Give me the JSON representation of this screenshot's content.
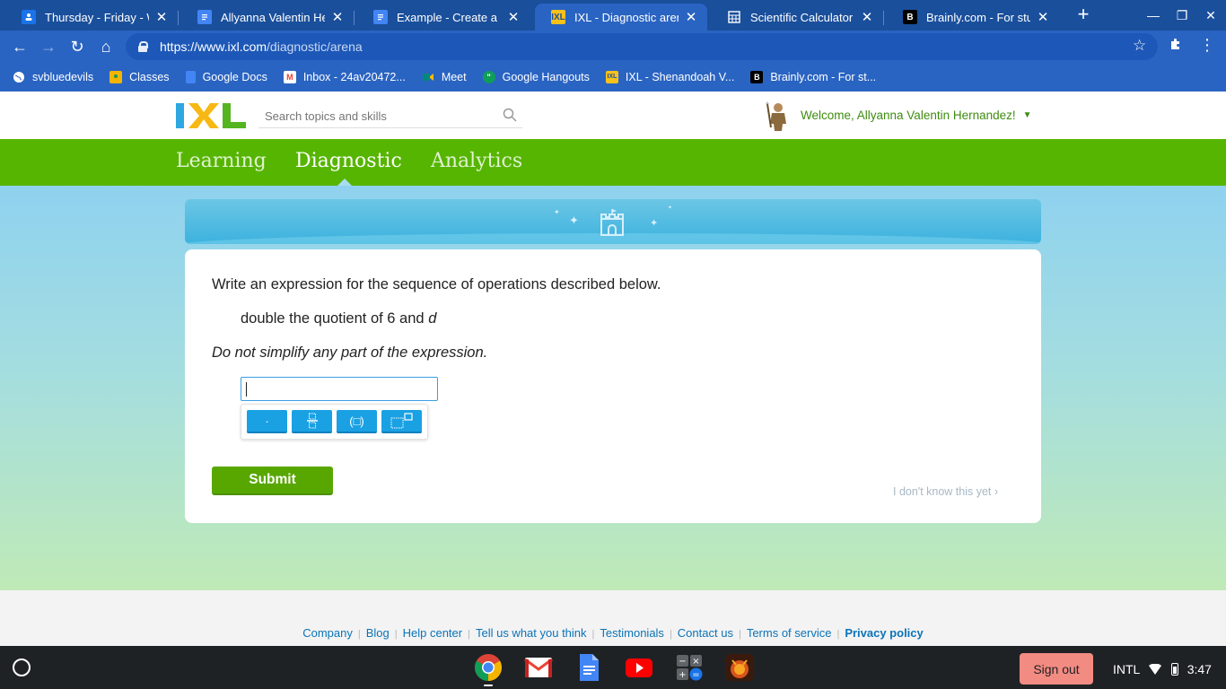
{
  "browser": {
    "tabs": [
      {
        "title": "Thursday - Friday - Wedn",
        "icon": "classroom-icon",
        "icon_color": "#1a73e8"
      },
      {
        "title": "Allyanna Valentin Herna",
        "icon": "docs-icon",
        "icon_color": "#4285f4"
      },
      {
        "title": "Example - Create a Char",
        "icon": "docs-icon",
        "icon_color": "#4285f4"
      },
      {
        "title": "IXL - Diagnostic arena",
        "icon": "ixl-icon",
        "icon_color": "#f9c11a",
        "active": true
      },
      {
        "title": "Scientific Calculator",
        "icon": "calculator-icon",
        "icon_color": "#ffffff"
      },
      {
        "title": "Brainly.com - For studen",
        "icon": "brainly-icon",
        "icon_color": "#000000"
      }
    ],
    "url_host": "https://www.ixl.com",
    "url_path": "/diagnostic/arena",
    "bookmarks": [
      {
        "label": "svbluedevils",
        "icon": "globe-icon",
        "color": "#ffffff"
      },
      {
        "label": "Classes",
        "icon": "classroom-icon",
        "color": "#f4b400"
      },
      {
        "label": "Google Docs",
        "icon": "docs-icon",
        "color": "#4285f4"
      },
      {
        "label": "Inbox - 24av20472...",
        "icon": "gmail-icon",
        "color": "#ea4335"
      },
      {
        "label": "Meet",
        "icon": "meet-icon",
        "color": "#00897b"
      },
      {
        "label": "Google Hangouts",
        "icon": "hangouts-icon",
        "color": "#0f9d58"
      },
      {
        "label": "IXL - Shenandoah V...",
        "icon": "ixl-icon",
        "color": "#f9c11a"
      },
      {
        "label": "Brainly.com - For st...",
        "icon": "brainly-icon",
        "color": "#000000"
      }
    ]
  },
  "ixl": {
    "logo_text": "IXL",
    "search_placeholder": "Search topics and skills",
    "welcome": "Welcome, Allyanna Valentin Hernandez!",
    "nav": [
      {
        "label": "Learning"
      },
      {
        "label": "Diagnostic",
        "active": true
      },
      {
        "label": "Analytics"
      }
    ],
    "question": {
      "prompt": "Write an expression for the sequence of operations described below.",
      "expression_text": "double the quotient of 6 and ",
      "expression_var": "d",
      "note": "Do not simplify any part of the expression.",
      "answer_value": "",
      "keypad": [
        {
          "label": "·",
          "name": "multiply-dot-key"
        },
        {
          "label": "fraction",
          "name": "fraction-key"
        },
        {
          "label": "(□)",
          "name": "parentheses-key"
        },
        {
          "label": "exponent",
          "name": "exponent-key"
        }
      ]
    },
    "submit_label": "Submit",
    "idk_label": "I don't know this yet ›",
    "footer_links": [
      "Company",
      "Blog",
      "Help center",
      "Tell us what you think",
      "Testimonials",
      "Contact us",
      "Terms of service",
      "Privacy policy"
    ]
  },
  "colors": {
    "ixl_green": "#56b501",
    "submit_green": "#58a700",
    "keypad_blue": "#1aa1e4",
    "chrome_blue": "#2a64c2"
  },
  "shelf": {
    "signout_label": "Sign out",
    "ime": "INTL",
    "time": "3:47",
    "apps": [
      "chrome-icon",
      "gmail-icon",
      "docs-icon",
      "youtube-icon",
      "calculator-icon",
      "game-icon"
    ]
  }
}
